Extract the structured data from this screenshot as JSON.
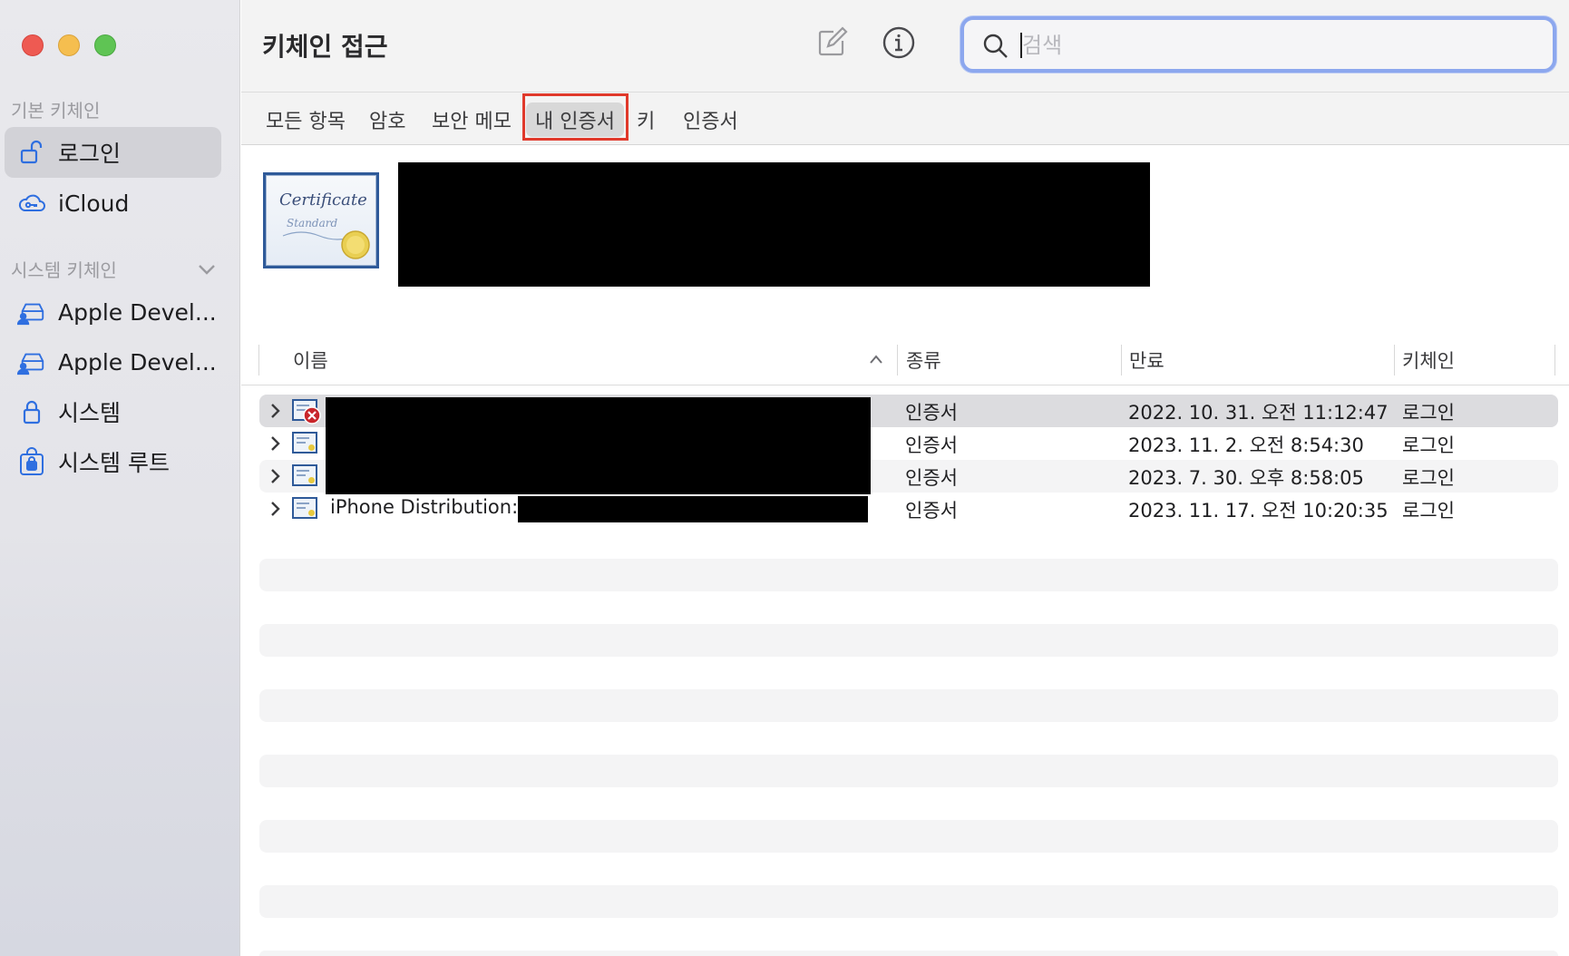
{
  "window": {
    "title": "키체인 접근"
  },
  "sidebar": {
    "default_section": "기본 키체인",
    "default_items": [
      {
        "label": "로그인",
        "icon": "lock-open-icon",
        "selected": true
      },
      {
        "label": "iCloud",
        "icon": "cloud-key-icon",
        "selected": false
      }
    ],
    "system_section": "시스템 키체인",
    "system_items": [
      {
        "label": "Apple Devel...",
        "icon": "drive-person-icon"
      },
      {
        "label": "Apple Devel...",
        "icon": "drive-person-icon"
      },
      {
        "label": "시스템",
        "icon": "lock-icon"
      },
      {
        "label": "시스템 루트",
        "icon": "lock-cabinet-icon"
      }
    ]
  },
  "toolbar": {
    "compose_icon": "compose-icon",
    "info_icon": "info-icon",
    "search_placeholder": "검색"
  },
  "tabs": [
    {
      "label": "모든 항목",
      "selected": false
    },
    {
      "label": "암호",
      "selected": false
    },
    {
      "label": "보안 메모",
      "selected": false
    },
    {
      "label": "내 인증서",
      "selected": true
    },
    {
      "label": "키",
      "selected": false
    },
    {
      "label": "인증서",
      "selected": false
    }
  ],
  "cert_header": {
    "icon_text_1": "Certificate",
    "icon_text_2": "Standard"
  },
  "table": {
    "columns": {
      "name": "이름",
      "kind": "종류",
      "expires": "만료",
      "keychain": "키체인"
    },
    "rows": [
      {
        "name": "",
        "kind": "인증서",
        "expires": "2022. 10. 31. 오전 11:12:47",
        "keychain": "로그인",
        "invalid": true
      },
      {
        "name": "",
        "kind": "인증서",
        "expires": "2023. 11. 2. 오전 8:54:30",
        "keychain": "로그인",
        "invalid": false
      },
      {
        "name": "",
        "kind": "인증서",
        "expires": "2023. 7. 30. 오후 8:58:05",
        "keychain": "로그인",
        "invalid": false
      },
      {
        "name": "iPhone Distribution:",
        "kind": "인증서",
        "expires": "2023. 11. 17. 오전 10:20:35",
        "keychain": "로그인",
        "invalid": false
      }
    ]
  }
}
